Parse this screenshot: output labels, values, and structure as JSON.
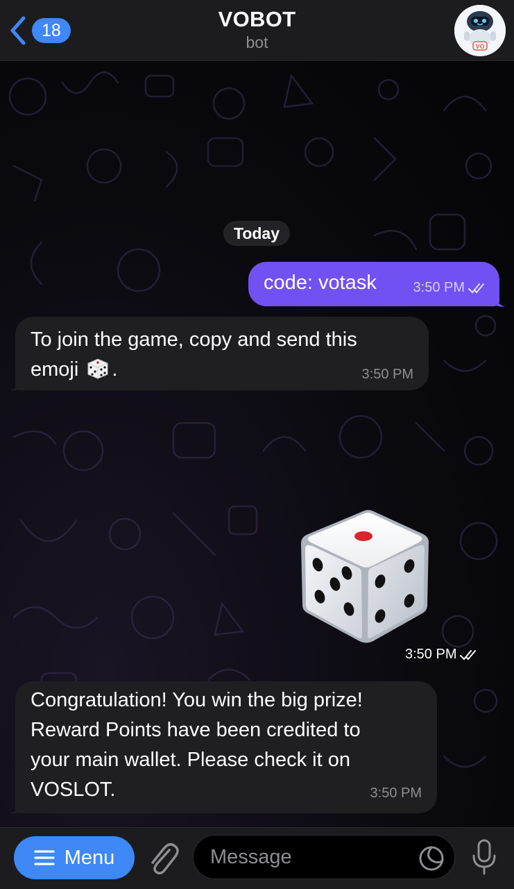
{
  "header": {
    "unread_count": "18",
    "title": "VOBOT",
    "subtitle": "bot",
    "avatar_text": "VO"
  },
  "chat": {
    "date_separator": "Today",
    "messages": [
      {
        "direction": "outgoing",
        "text": "code: votask",
        "time": "3:50 PM",
        "status": "read"
      },
      {
        "direction": "incoming",
        "text_line1": "To join the game, copy and send this",
        "text_line2_prefix": "emoji ",
        "text_line2_suffix": ".",
        "time": "3:50 PM"
      },
      {
        "direction": "outgoing",
        "type": "dice",
        "time": "3:50 PM",
        "status": "read"
      },
      {
        "direction": "incoming",
        "lines": [
          "Congratulation! You win the big prize!",
          "Reward Points have been credited to",
          "your main wallet. Please check it on",
          "VOSLOT."
        ],
        "time": "3:50 PM"
      }
    ]
  },
  "composer": {
    "menu_label": "Menu",
    "placeholder": "Message"
  },
  "colors": {
    "accent": "#3e88f7",
    "outgoing_bubble": "#7251f2",
    "incoming_bubble": "#1f1f22",
    "header_bg": "#1c1c1e"
  },
  "icons": [
    "chevron-left-icon",
    "paperclip-icon",
    "sticker-icon",
    "microphone-icon",
    "read-checkmarks-icon",
    "hamburger-icon",
    "dice-emoji"
  ]
}
